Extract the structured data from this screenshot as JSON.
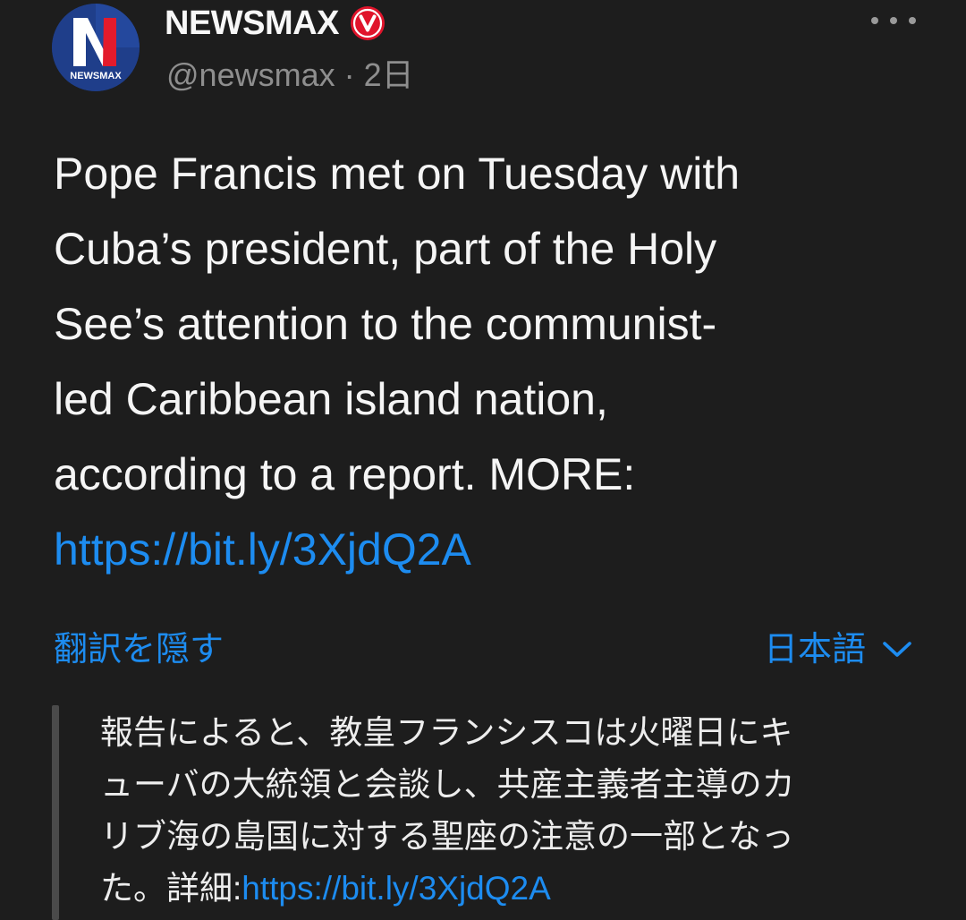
{
  "tweet": {
    "display_name": "NEWSMAX",
    "handle": "@newsmax",
    "separator": "·",
    "time": "2日",
    "avatar_text": "NEWSMAX",
    "avatar_letter": "N",
    "text_lines": [
      "Pope Francis met on Tuesday with",
      "Cuba’s president, part of the Holy",
      "See’s attention to the communist-",
      "led Caribbean island nation,",
      "according to a report. MORE:"
    ],
    "link": "https://bit.ly/3XjdQ2A"
  },
  "translation": {
    "toggle_label": "翻訳を隠す",
    "language": "日本語",
    "lines": [
      "報告によると、教皇フランシスコは火曜日にキ",
      "ューバの大統領と会談し、共産主義者主導のカ",
      "リブ海の島国に対する聖座の注意の一部となっ"
    ],
    "last_line_prefix": "た。詳細:",
    "link": "https://bit.ly/3XjdQ2A"
  },
  "colors": {
    "background": "#1d1d1d",
    "text": "#f5f5f5",
    "secondary": "#8e8e8e",
    "link": "#1d8cf0",
    "verified_badge": "#e0142b"
  },
  "icons": {
    "verified": "verified-badge-icon",
    "more": "more-options-icon",
    "chevron": "chevron-down-icon"
  }
}
